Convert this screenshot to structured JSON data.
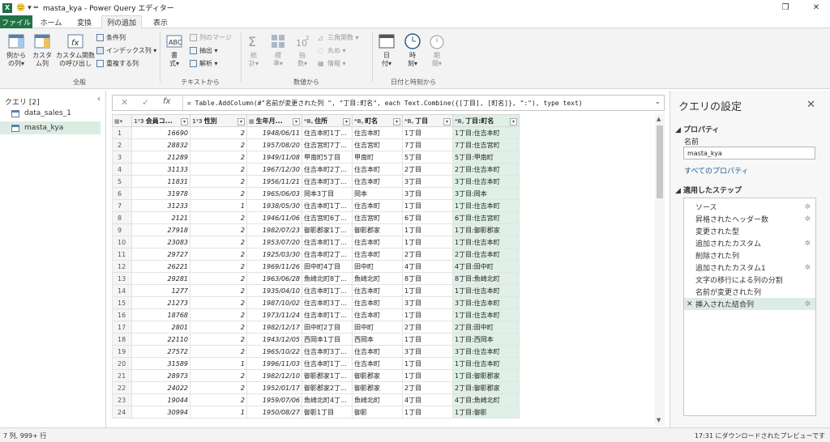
{
  "titlebar": {
    "app_icon": "X",
    "quick_access": "🙂 ▾ ═",
    "title": "masta_kya - Power Query エディター",
    "restore_icon": "❐",
    "close_icon": "✕"
  },
  "tabs": [
    {
      "label": "ファイル"
    },
    {
      "label": "ホーム"
    },
    {
      "label": "変換"
    },
    {
      "label": "列の追加"
    },
    {
      "label": "表示"
    }
  ],
  "ribbon": {
    "general": {
      "label": "全般",
      "col_from_examples": "例から\nの列▾",
      "custom_col": "カスタ\nム列",
      "invoke_func": "カスタム関数\nの呼び出し",
      "conditional_col": "条件列",
      "index_col": "インデックス列 ▾",
      "duplicate_col": "重複する列"
    },
    "text": {
      "label": "テキストから",
      "format": "書\n式▾",
      "merge": "列のマージ",
      "extract": "抽出 ▾",
      "parse": "解析 ▾"
    },
    "number": {
      "label": "数値から",
      "stats": "統\n計▾",
      "standard": "標\n準▾",
      "scientific": "指\n数▾",
      "trig": "三角関数 ▾",
      "round": "丸め ▾",
      "info": "情報 ▾"
    },
    "datetime": {
      "label": "日付と時刻から",
      "date": "日\n付▾",
      "time": "時\n刻▾",
      "duration": "期\n間▾"
    }
  },
  "queries": {
    "header": "クエリ [2]",
    "items": [
      {
        "label": "data_sales_1"
      },
      {
        "label": "masta_kya"
      }
    ]
  },
  "formula": {
    "cancel": "✕",
    "commit": "✓",
    "fx": "fx",
    "text": "= Table.AddColumn(#\"名前が変更された列 \", \"丁目:町名\", each Text.Combine({[丁目], [町名]}, \":\"), type text)",
    "expand": "⌄"
  },
  "grid": {
    "columns": [
      {
        "type": "1²3",
        "label": "会員コ..."
      },
      {
        "type": "1²3",
        "label": "性別"
      },
      {
        "type": "▦",
        "label": "生年月..."
      },
      {
        "type": "ᴬB꜀",
        "label": "住所"
      },
      {
        "type": "ᴬB꜀",
        "label": "町名"
      },
      {
        "type": "ᴬB꜀",
        "label": "丁目"
      },
      {
        "type": "ᴬB꜀",
        "label": "丁目:町名"
      }
    ],
    "rows": [
      [
        "1",
        "16690",
        "2",
        "1948/06/11",
        "住吉本町1丁...",
        "住吉本町",
        "1丁目",
        "1丁目:住吉本町"
      ],
      [
        "2",
        "28832",
        "2",
        "1957/08/20",
        "住吉宮町7丁...",
        "住吉宮町",
        "7丁目",
        "7丁目:住吉宮町"
      ],
      [
        "3",
        "21289",
        "2",
        "1949/11/08",
        "甲南町5丁目",
        "甲南町",
        "5丁目",
        "5丁目:甲南町"
      ],
      [
        "4",
        "31133",
        "2",
        "1967/12/30",
        "住吉本町2丁...",
        "住吉本町",
        "2丁目",
        "2丁目:住吉本町"
      ],
      [
        "5",
        "11831",
        "2",
        "1956/11/21",
        "住吉本町3丁...",
        "住吉本町",
        "3丁目",
        "3丁目:住吉本町"
      ],
      [
        "6",
        "31978",
        "2",
        "1965/06/03",
        "岡本3丁目",
        "岡本",
        "3丁目",
        "3丁目:岡本"
      ],
      [
        "7",
        "31233",
        "1",
        "1938/05/30",
        "住吉本町1丁...",
        "住吉本町",
        "1丁目",
        "1丁目:住吉本町"
      ],
      [
        "8",
        "2121",
        "2",
        "1946/11/06",
        "住吉宮町6丁...",
        "住吉宮町",
        "6丁目",
        "6丁目:住吉宮町"
      ],
      [
        "9",
        "27918",
        "2",
        "1982/07/23",
        "御影郡家1丁...",
        "御影郡家",
        "1丁目",
        "1丁目:御影郡家"
      ],
      [
        "10",
        "23083",
        "2",
        "1953/07/20",
        "住吉本町1丁...",
        "住吉本町",
        "1丁目",
        "1丁目:住吉本町"
      ],
      [
        "11",
        "29727",
        "2",
        "1925/03/30",
        "住吉本町2丁...",
        "住吉本町",
        "2丁目",
        "2丁目:住吉本町"
      ],
      [
        "12",
        "26221",
        "2",
        "1969/11/26",
        "田中町4丁目",
        "田中町",
        "4丁目",
        "4丁目:田中町"
      ],
      [
        "13",
        "29281",
        "2",
        "1963/06/28",
        "魚崎北町8丁...",
        "魚崎北町",
        "8丁目",
        "8丁目:魚崎北町"
      ],
      [
        "14",
        "1277",
        "2",
        "1935/04/10",
        "住吉本町1丁...",
        "住吉本町",
        "1丁目",
        "1丁目:住吉本町"
      ],
      [
        "15",
        "21273",
        "2",
        "1987/10/02",
        "住吉本町3丁...",
        "住吉本町",
        "3丁目",
        "3丁目:住吉本町"
      ],
      [
        "16",
        "18768",
        "2",
        "1973/11/24",
        "住吉本町1丁...",
        "住吉本町",
        "1丁目",
        "1丁目:住吉本町"
      ],
      [
        "17",
        "2801",
        "2",
        "1982/12/17",
        "田中町2丁目",
        "田中町",
        "2丁目",
        "2丁目:田中町"
      ],
      [
        "18",
        "22110",
        "2",
        "1943/12/05",
        "西岡本1丁目",
        "西岡本",
        "1丁目",
        "1丁目:西岡本"
      ],
      [
        "19",
        "27572",
        "2",
        "1965/10/22",
        "住吉本町3丁...",
        "住吉本町",
        "3丁目",
        "3丁目:住吉本町"
      ],
      [
        "20",
        "31589",
        "1",
        "1996/11/03",
        "住吉本町1丁...",
        "住吉本町",
        "1丁目",
        "1丁目:住吉本町"
      ],
      [
        "21",
        "28973",
        "2",
        "1982/12/10",
        "御影郡家1丁...",
        "御影郡家",
        "1丁目",
        "1丁目:御影郡家"
      ],
      [
        "22",
        "24022",
        "2",
        "1952/01/17",
        "御影郡家2丁...",
        "御影郡家",
        "2丁目",
        "2丁目:御影郡家"
      ],
      [
        "23",
        "19044",
        "2",
        "1959/07/06",
        "魚崎北町4丁...",
        "魚崎北町",
        "4丁目",
        "4丁目:魚崎北町"
      ],
      [
        "24",
        "30994",
        "1",
        "1950/08/27",
        "御影1丁目",
        "御影",
        "1丁目",
        "1丁目:御影"
      ]
    ]
  },
  "settings": {
    "title": "クエリの設定",
    "close": "✕",
    "properties_header": "◢ プロパティ",
    "name_label": "名前",
    "name_value": "masta_kya",
    "all_properties": "すべてのプロパティ",
    "steps_header": "◢ 適用したステップ",
    "steps": [
      {
        "label": "ソース",
        "gear": true
      },
      {
        "label": "昇格されたヘッダー数",
        "gear": true
      },
      {
        "label": "変更された型",
        "gear": false
      },
      {
        "label": "追加されたカスタム",
        "gear": true
      },
      {
        "label": "削除された列",
        "gear": false
      },
      {
        "label": "追加されたカスタム1",
        "gear": true
      },
      {
        "label": "文字の移行による列の分割",
        "gear": false
      },
      {
        "label": "名前が変更された列",
        "gear": false
      },
      {
        "label": "挿入された結合列",
        "gear": true,
        "selected": true
      }
    ]
  },
  "status": {
    "left": "7 列, 999+ 行",
    "right": "17:31 にダウンロードされたプレビューです"
  },
  "colors": {
    "accent": "#217346",
    "selected_col": "#dff0e6",
    "selected_item": "#dcece2"
  }
}
